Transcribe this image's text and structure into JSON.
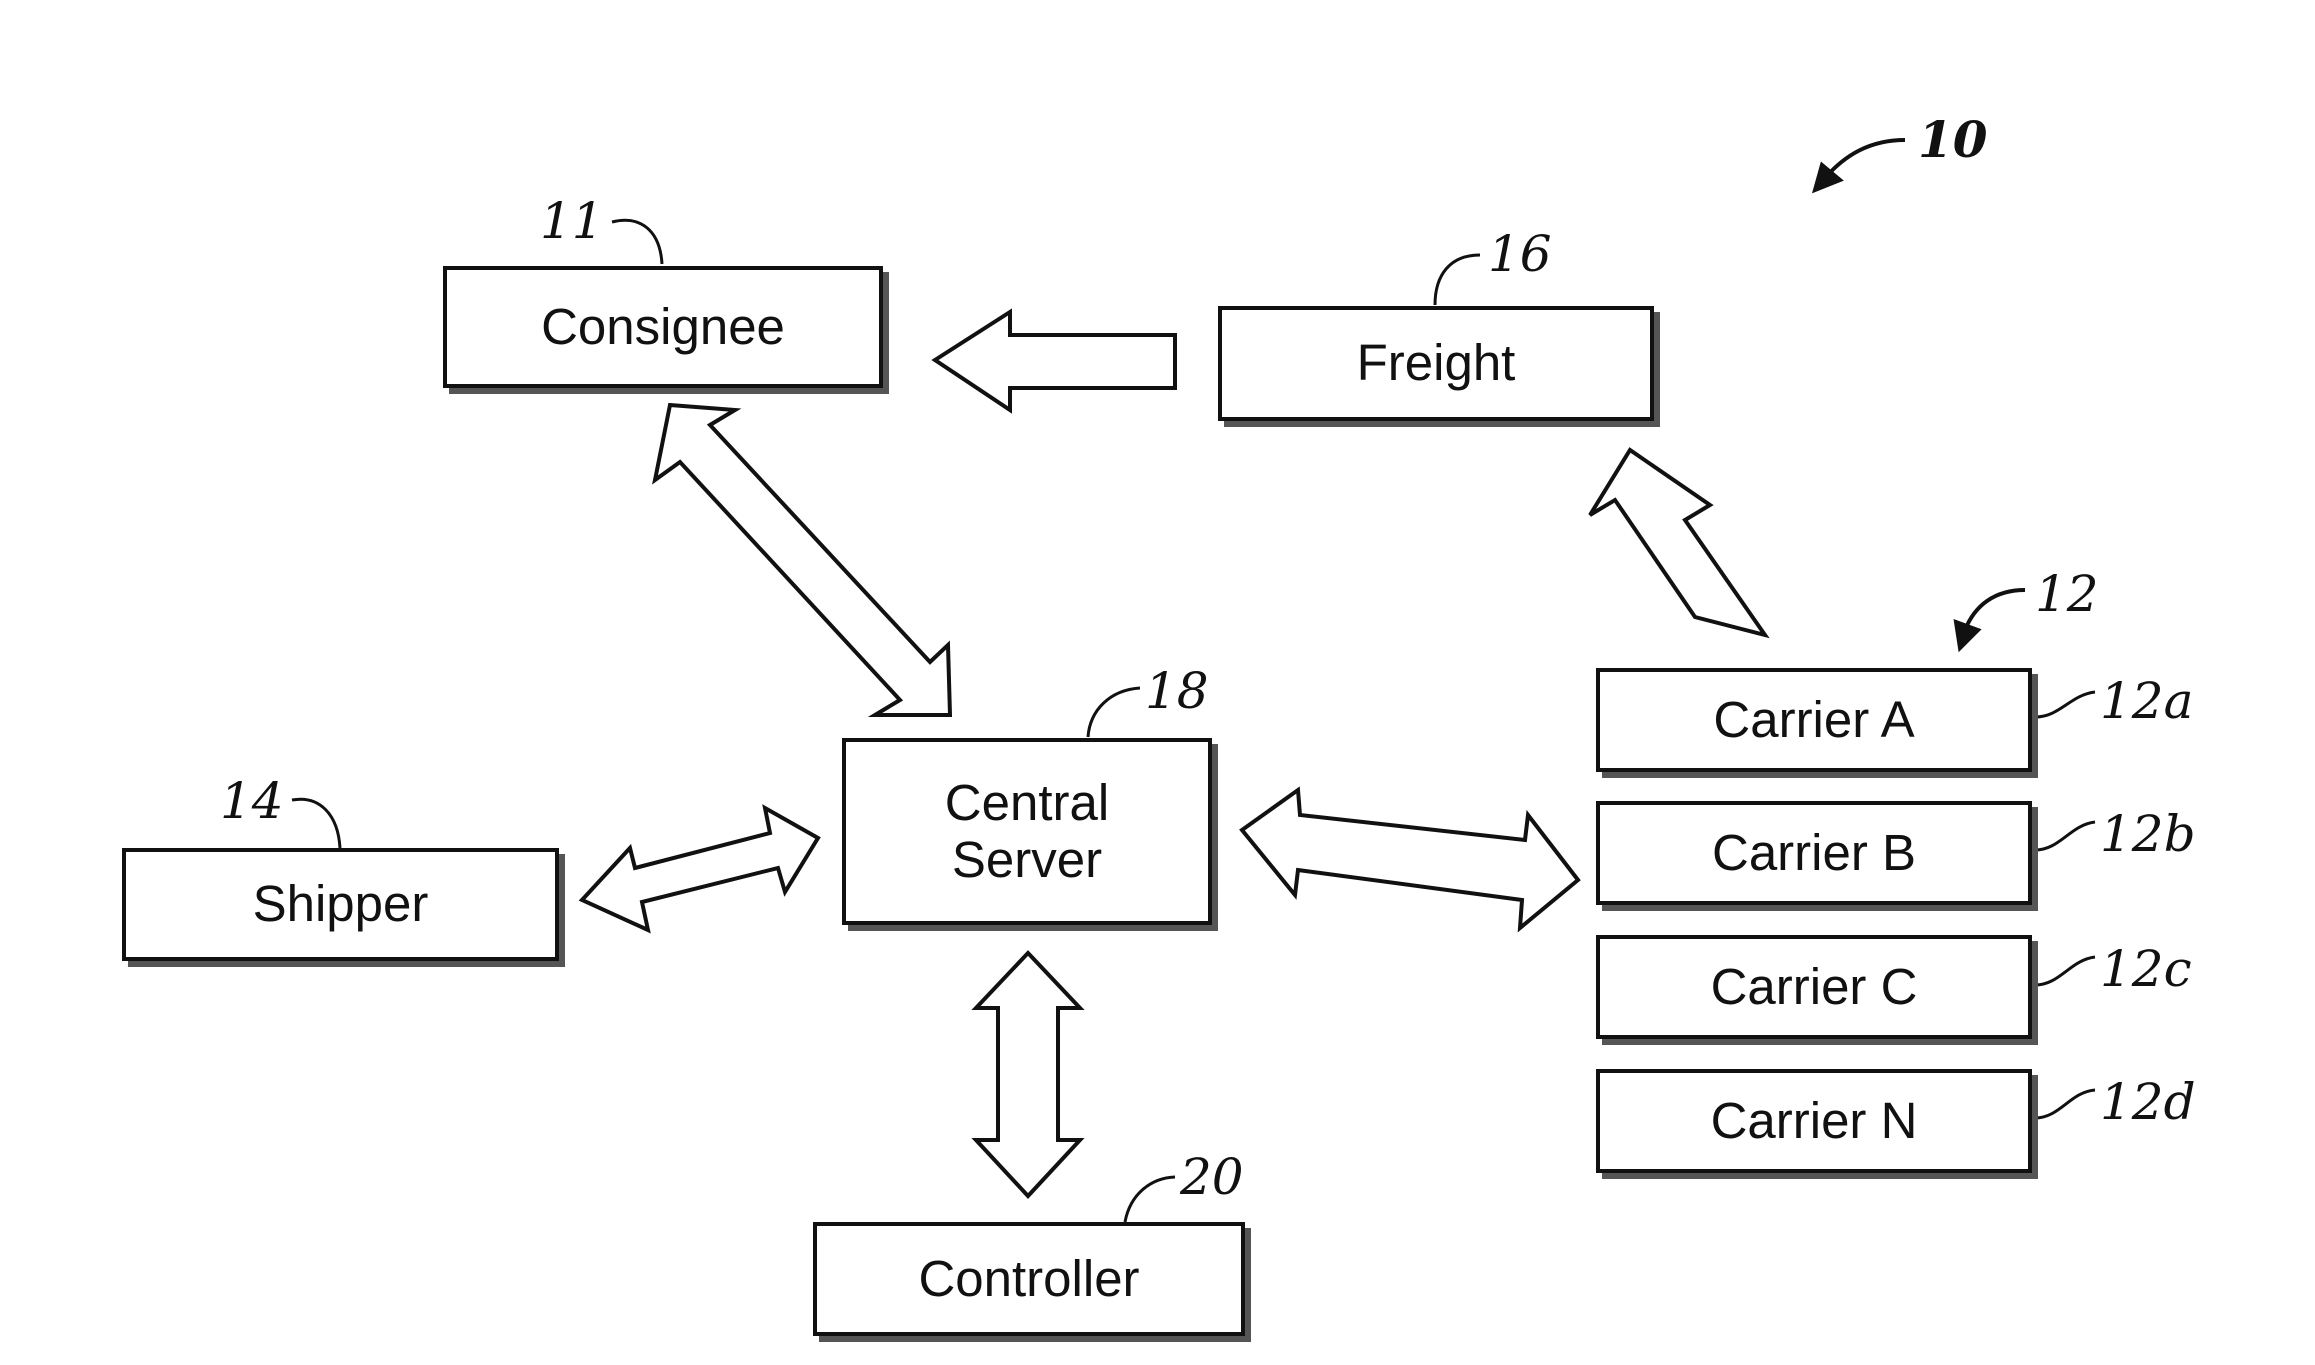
{
  "figure": {
    "ref": "10",
    "nodes": {
      "consignee": {
        "label": "Consignee",
        "ref": "11"
      },
      "freight": {
        "label": "Freight",
        "ref": "16"
      },
      "central_server": {
        "label_line1": "Central",
        "label_line2": "Server",
        "ref": "18"
      },
      "shipper": {
        "label": "Shipper",
        "ref": "14"
      },
      "controller": {
        "label": "Controller",
        "ref": "20"
      },
      "carriers_group": {
        "ref": "12"
      },
      "carriers": [
        {
          "label": "Carrier A",
          "ref": "12a"
        },
        {
          "label": "Carrier B",
          "ref": "12b"
        },
        {
          "label": "Carrier C",
          "ref": "12c"
        },
        {
          "label": "Carrier N",
          "ref": "12d"
        }
      ]
    },
    "connections": [
      {
        "from": "freight",
        "to": "consignee",
        "type": "one-way"
      },
      {
        "from": "carriers",
        "to": "freight",
        "type": "one-way"
      },
      {
        "from": "consignee",
        "to": "central_server",
        "type": "two-way"
      },
      {
        "from": "shipper",
        "to": "central_server",
        "type": "two-way"
      },
      {
        "from": "central_server",
        "to": "carriers",
        "type": "two-way"
      },
      {
        "from": "central_server",
        "to": "controller",
        "type": "two-way"
      }
    ]
  }
}
